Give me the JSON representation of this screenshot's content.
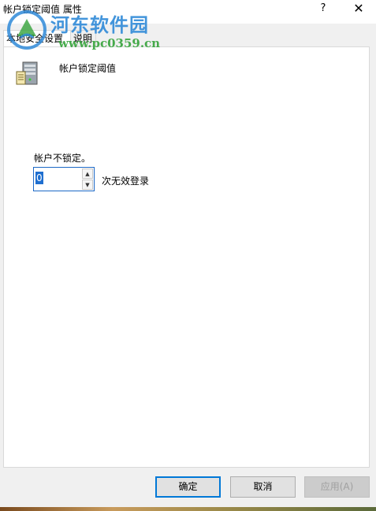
{
  "window": {
    "title": "帐户锁定阈值 属性",
    "help_label": "?",
    "close_label": "✕"
  },
  "watermark": {
    "brand": "河东软件园",
    "url": "www.pc0359.cn"
  },
  "tabs": [
    {
      "label": "本地安全设置",
      "selected": true
    },
    {
      "label": "说明",
      "selected": false
    }
  ],
  "policy": {
    "icon": "server-policy-icon",
    "name": "帐户锁定阈值",
    "status_text": "帐户不锁定。",
    "threshold_value": "0",
    "unit_text": "次无效登录"
  },
  "buttons": {
    "ok_label": "确定",
    "cancel_label": "取消",
    "apply_label": "应用(A)"
  },
  "colors": {
    "accent": "#0078d7",
    "selection": "#1f6fd0",
    "watermark_blue": "#2f8ad8",
    "watermark_green": "#34a33a"
  }
}
